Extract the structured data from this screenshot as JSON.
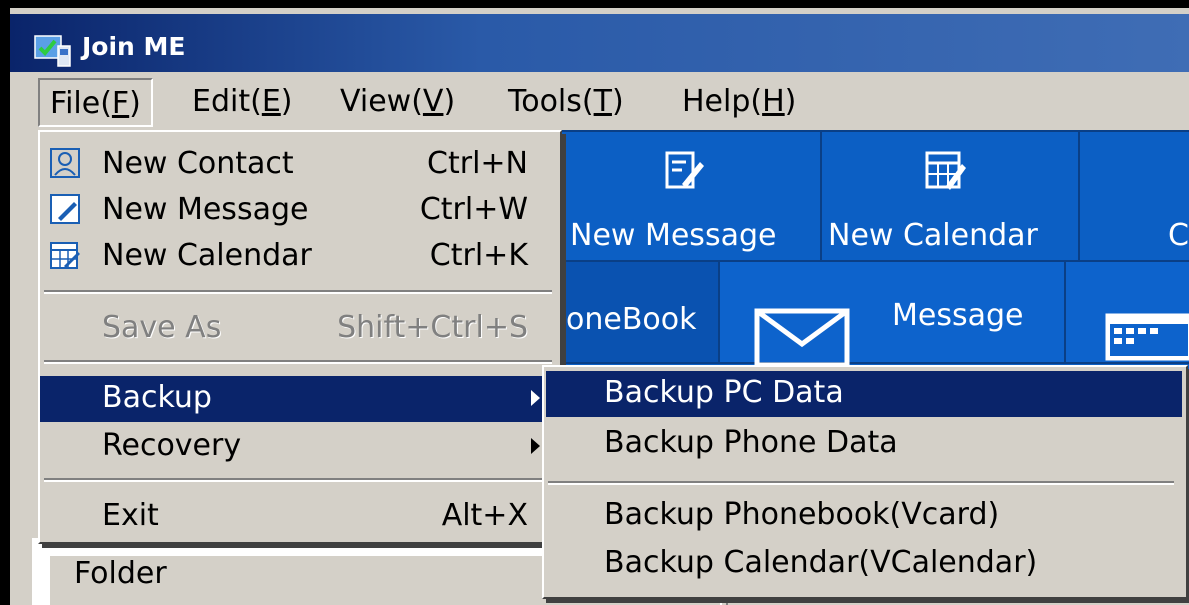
{
  "window": {
    "title": "Join ME",
    "app_icon": "join-me-app-icon"
  },
  "menubar": [
    {
      "id": "file",
      "label": "File(F)",
      "pre": "File(",
      "key": "F",
      "post": ")"
    },
    {
      "id": "edit",
      "label": "Edit(E)",
      "pre": "Edit(",
      "key": "E",
      "post": ")"
    },
    {
      "id": "view",
      "label": "View(V)",
      "pre": "View(",
      "key": "V",
      "post": ")"
    },
    {
      "id": "tools",
      "label": "Tools(T)",
      "pre": "Tools(",
      "key": "T",
      "post": ")"
    },
    {
      "id": "help",
      "label": "Help(H)",
      "pre": "Help(",
      "key": "H",
      "post": ")"
    }
  ],
  "toolbar": {
    "new_message": "New Message",
    "new_calendar": "New Calendar",
    "partial_next": "C"
  },
  "tabs": {
    "phonebook": "oneBook",
    "message": "Message"
  },
  "file_menu": {
    "new_contact": {
      "label": "New Contact",
      "shortcut": "Ctrl+N",
      "icon": "contact-icon"
    },
    "new_message": {
      "label": "New Message",
      "shortcut": "Ctrl+W",
      "icon": "message-edit-icon"
    },
    "new_calendar": {
      "label": "New Calendar",
      "shortcut": "Ctrl+K",
      "icon": "calendar-edit-icon"
    },
    "save_as": {
      "label": "Save As",
      "shortcut": "Shift+Ctrl+S",
      "disabled": true
    },
    "backup": {
      "label": "Backup",
      "highlighted": true
    },
    "recovery": {
      "label": "Recovery"
    },
    "exit": {
      "label": "Exit",
      "shortcut": "Alt+X"
    }
  },
  "backup_submenu": {
    "backup_pc_data": "Backup PC Data",
    "backup_phone_data": "Backup Phone Data",
    "backup_phonebook_vcard": "Backup Phonebook(Vcard)",
    "backup_calendar_vcalendar": "Backup Calendar(VCalendar)"
  },
  "lower_panel": {
    "folder_header": "Folder"
  },
  "colors": {
    "titlebar": "#0a246a",
    "menu_bg": "#d4d0c8",
    "highlight": "#0a246a",
    "toolbar_blue": "#0c5fc4"
  }
}
